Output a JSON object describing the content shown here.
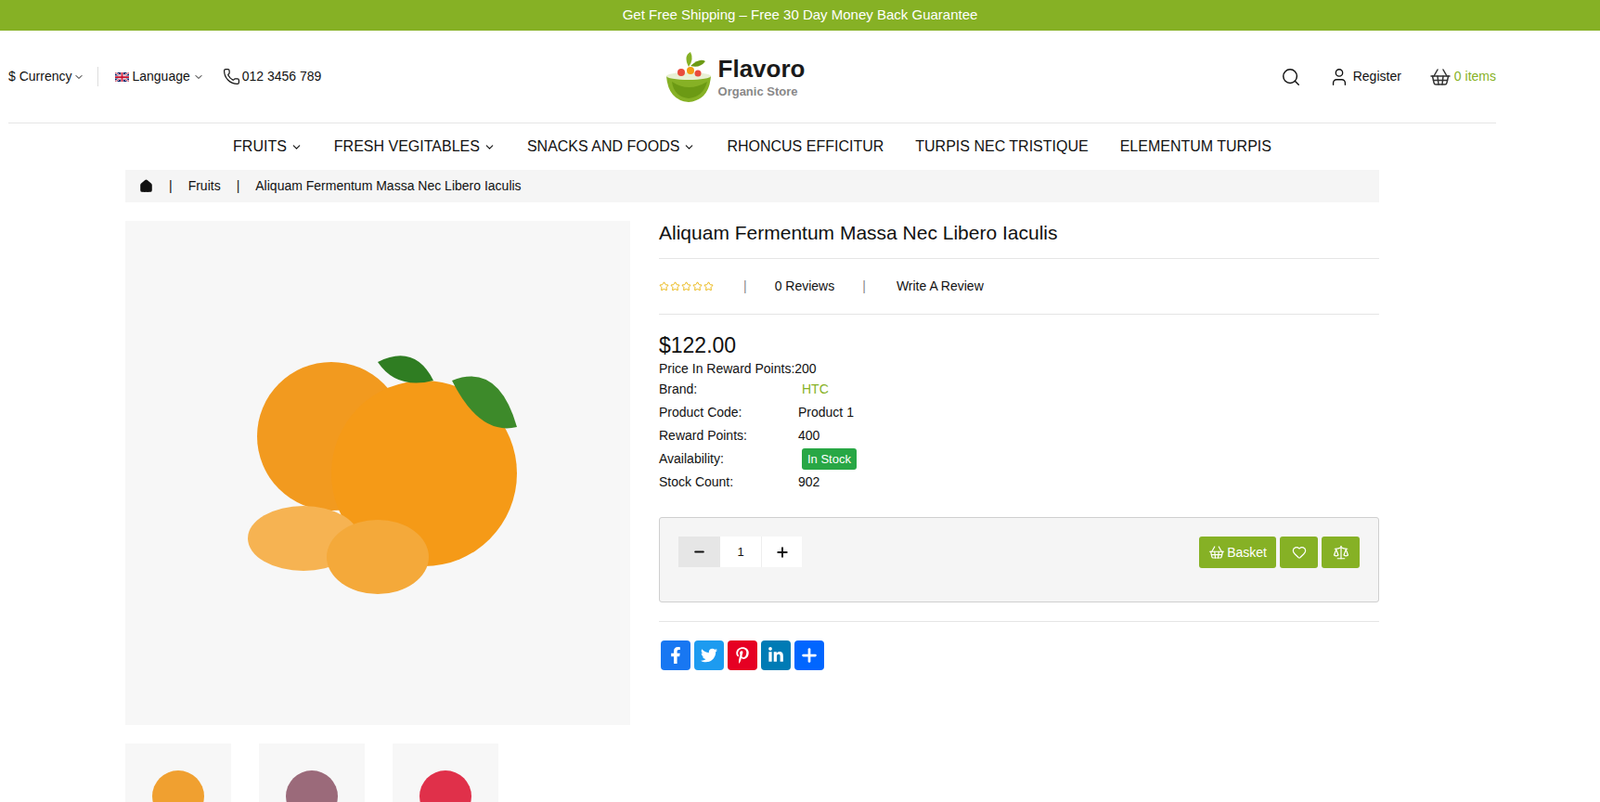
{
  "promo_bar": {
    "text": "Get Free Shipping – Free 30 Day Money Back Guarantee"
  },
  "header": {
    "currency": "$ Currency",
    "language": "Language",
    "phone": "012 3456 789",
    "logo": {
      "name": "Flavoro",
      "tagline": "Organic Store"
    },
    "register": "Register",
    "cart": "0 items"
  },
  "nav": [
    {
      "label": "FRUITS",
      "dropdown": true
    },
    {
      "label": "FRESH VEGITABLES",
      "dropdown": true
    },
    {
      "label": "SNACKS AND FOODS",
      "dropdown": true
    },
    {
      "label": "RHONCUS EFFICITUR",
      "dropdown": false
    },
    {
      "label": "TURPIS NEC TRISTIQUE",
      "dropdown": false
    },
    {
      "label": "ELEMENTUM TURPIS",
      "dropdown": false
    }
  ],
  "breadcrumb": {
    "separator": "|",
    "items": [
      "Fruits",
      "Aliquam Fermentum Massa Nec Libero Iaculis"
    ]
  },
  "product": {
    "title": "Aliquam Fermentum Massa Nec Libero Iaculis",
    "stars": 0,
    "separator": "|",
    "reviews": "0 Reviews",
    "write_review": "Write A Review",
    "price": "$122.00",
    "reward_price_label": "Price In Reward Points:",
    "reward_price_value": "200",
    "details": [
      {
        "label": "Brand:",
        "value": "HTC",
        "kind": "link"
      },
      {
        "label": "Product Code:",
        "value": "Product 1",
        "kind": "text"
      },
      {
        "label": "Reward Points:",
        "value": "400",
        "kind": "text"
      },
      {
        "label": "Availability:",
        "value": "In Stock",
        "kind": "badge"
      },
      {
        "label": "Stock Count:",
        "value": "902",
        "kind": "text"
      }
    ],
    "quantity": "1",
    "basket_button": "Basket"
  },
  "thumbnails": [
    {
      "color": "#f0a030"
    },
    {
      "color": "#9b6a7a"
    },
    {
      "color": "#e0304a"
    }
  ],
  "share": [
    {
      "name": "Facebook",
      "color": "#1877f2"
    },
    {
      "name": "Twitter",
      "color": "#1d9bf0"
    },
    {
      "name": "Pinterest",
      "color": "#e60023"
    },
    {
      "name": "LinkedIn",
      "color": "#007bb5"
    },
    {
      "name": "Share",
      "color": "#0166ff"
    }
  ]
}
